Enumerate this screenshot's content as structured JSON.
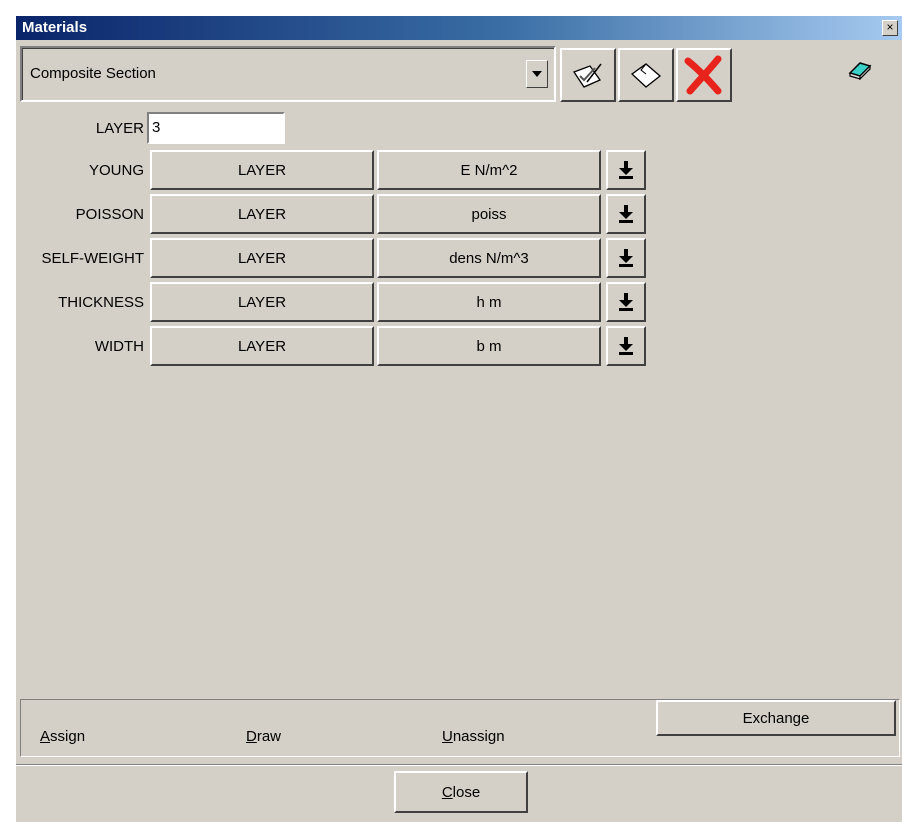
{
  "window": {
    "title": "Materials",
    "close_glyph": "×"
  },
  "section_combo": {
    "value": "Composite Section"
  },
  "toolbar": {
    "icons": [
      "edit-material-icon",
      "new-material-icon",
      "delete-material-icon",
      "eraser-icon"
    ]
  },
  "layer": {
    "label": "LAYER",
    "value": "3"
  },
  "properties": [
    {
      "label": "YOUNG",
      "source": "LAYER",
      "variable": "E  N/m^2"
    },
    {
      "label": "POISSON",
      "source": "LAYER",
      "variable": "poiss"
    },
    {
      "label": "SELF-WEIGHT",
      "source": "LAYER",
      "variable": "dens  N/m^3"
    },
    {
      "label": "THICKNESS",
      "source": "LAYER",
      "variable": "h  m"
    },
    {
      "label": "WIDTH",
      "source": "LAYER",
      "variable": "b  m"
    }
  ],
  "actions": {
    "assign_first": "A",
    "assign_rest": "ssign",
    "draw_first": "D",
    "draw_rest": "raw",
    "unassign_first": "U",
    "unassign_rest": "nassign",
    "exchange": "Exchange"
  },
  "footer": {
    "close_first": "C",
    "close_rest": "lose"
  },
  "colors": {
    "face": "#d4d0c8",
    "title_start": "#0a246a",
    "title_end": "#a6caf0",
    "delete_red": "#e8231c"
  }
}
